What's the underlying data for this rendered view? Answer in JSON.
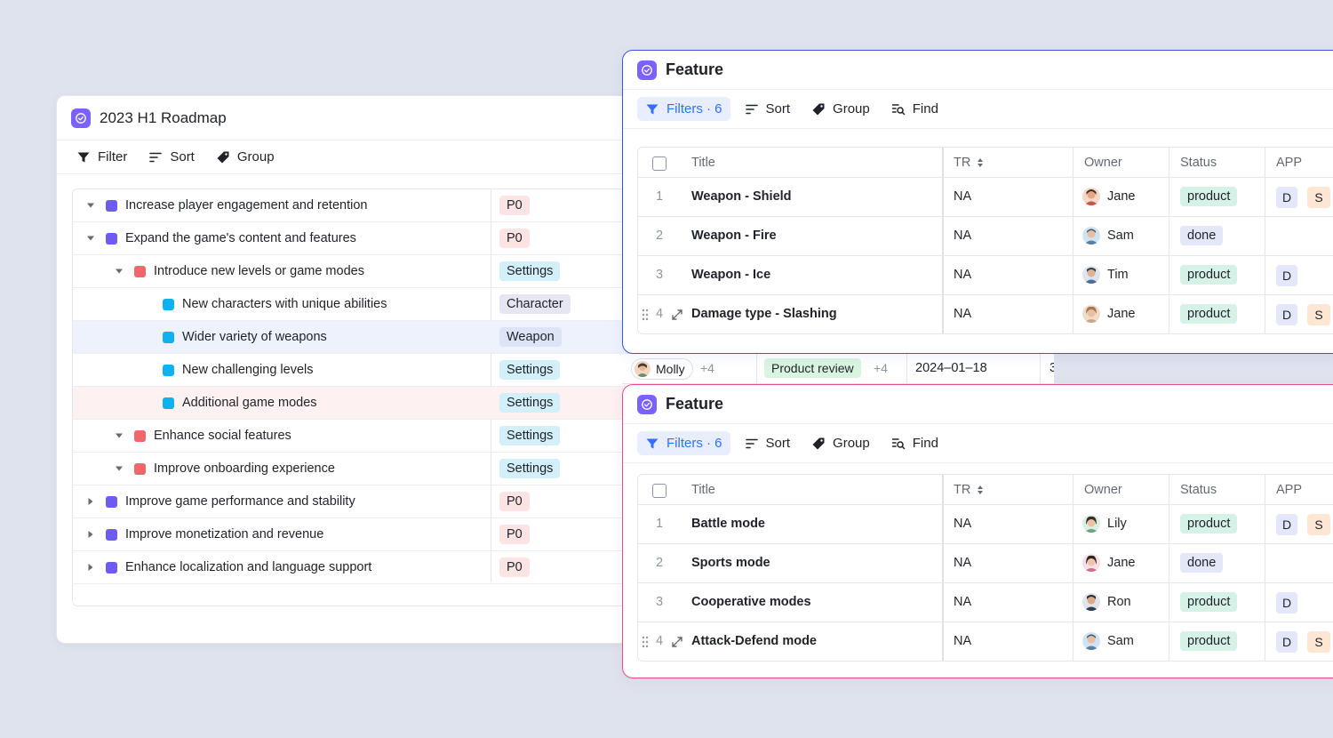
{
  "roadmap": {
    "title": "2023 H1 Roadmap",
    "toolbar": {
      "filter": "Filter",
      "sort": "Sort",
      "group": "Group"
    },
    "rows": [
      {
        "label": "Increase player engagement and retention",
        "tag": "P0"
      },
      {
        "label": "Expand the game's content and features",
        "tag": "P0"
      },
      {
        "label": "Introduce new levels or game modes",
        "tag": "Settings"
      },
      {
        "label": "New characters with unique abilities",
        "tag": "Character"
      },
      {
        "label": "Wider variety of weapons",
        "tag": "Weapon"
      },
      {
        "label": "New challenging levels",
        "tag": "Settings"
      },
      {
        "label": "Additional game modes",
        "tag": "Settings"
      },
      {
        "label": "Enhance social features",
        "tag": "Settings"
      },
      {
        "label": "Improve onboarding experience",
        "tag": "Settings"
      },
      {
        "label": "Improve game performance and stability",
        "tag": "P0"
      },
      {
        "label": "Improve monetization and revenue",
        "tag": "P0"
      },
      {
        "label": "Enhance localization and language support",
        "tag": "P0"
      }
    ]
  },
  "strip": {
    "owner": "Molly",
    "owner_more": "+4",
    "stage": "Product review",
    "stage_more": "+4",
    "date": "2024–01–18",
    "trailing": "3"
  },
  "feature1": {
    "title": "Feature",
    "toolbar": {
      "filters": "Filters · 6",
      "sort": "Sort",
      "group": "Group",
      "find": "Find"
    },
    "columns": {
      "title": "Title",
      "tr": "TR",
      "owner": "Owner",
      "status": "Status",
      "app": "APP"
    },
    "rows": [
      {
        "num": "1",
        "title": "Weapon - Shield",
        "tr": "NA",
        "owner": "Jane",
        "status": "product",
        "d": "D",
        "s": "S"
      },
      {
        "num": "2",
        "title": "Weapon - Fire",
        "tr": "NA",
        "owner": "Sam",
        "status": "done",
        "d": "",
        "s": ""
      },
      {
        "num": "3",
        "title": "Weapon - Ice",
        "tr": "NA",
        "owner": "Tim",
        "status": "product",
        "d": "D",
        "s": ""
      },
      {
        "num": "4",
        "title": "Damage type - Slashing",
        "tr": "NA",
        "owner": "Jane",
        "status": "product",
        "d": "D",
        "s": "S"
      }
    ]
  },
  "feature2": {
    "title": "Feature",
    "toolbar": {
      "filters": "Filters · 6",
      "sort": "Sort",
      "group": "Group",
      "find": "Find"
    },
    "columns": {
      "title": "Title",
      "tr": "TR",
      "owner": "Owner",
      "status": "Status",
      "app": "APP"
    },
    "rows": [
      {
        "num": "1",
        "title": "Battle mode",
        "tr": "NA",
        "owner": "Lily",
        "status": "product",
        "d": "D",
        "s": "S"
      },
      {
        "num": "2",
        "title": "Sports mode",
        "tr": "NA",
        "owner": "Jane",
        "status": "done",
        "d": "",
        "s": ""
      },
      {
        "num": "3",
        "title": "Cooperative modes",
        "tr": "NA",
        "owner": "Ron",
        "status": "product",
        "d": "D",
        "s": ""
      },
      {
        "num": "4",
        "title": "Attack-Defend mode",
        "tr": "NA",
        "owner": "Sam",
        "status": "product",
        "d": "D",
        "s": "S"
      }
    ]
  },
  "colors": {
    "background": "#dfe3ee",
    "accent_blue": "#3370ff",
    "app_purple": "#7b61ff",
    "feature1_border": "#3b55d9",
    "feature2_border": "#e54d8a"
  }
}
